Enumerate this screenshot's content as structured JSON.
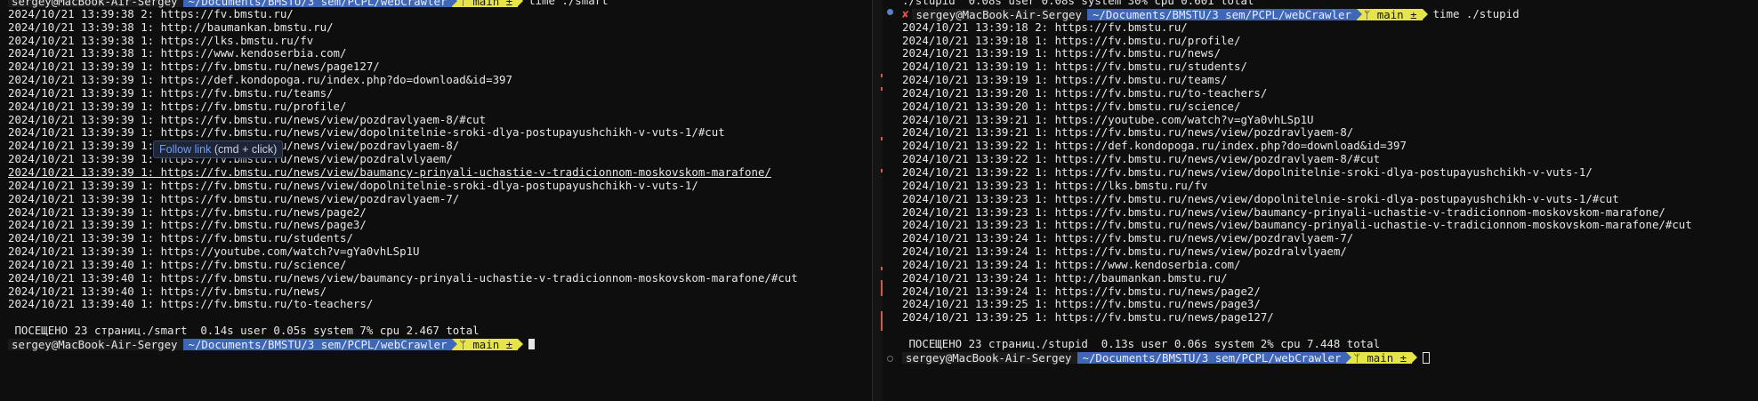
{
  "prompt": {
    "user_host": "sergey@MacBook-Air-Sergey",
    "path": "~/Documents/BMSTU/3 sem/PCPL/webCrawler",
    "git": "ᛘ main ±",
    "status_x": "✘"
  },
  "left": {
    "top_command": "time ./smart",
    "lines": [
      "2024/10/21 13:39:38 2: https://fv.bmstu.ru/",
      "2024/10/21 13:39:38 1: http://baumankan.bmstu.ru/",
      "2024/10/21 13:39:38 1: https://lks.bmstu.ru/fv",
      "2024/10/21 13:39:38 1: https://www.kendoserbia.com/",
      "2024/10/21 13:39:39 1: https://fv.bmstu.ru/news/page127/",
      "2024/10/21 13:39:39 1: https://def.kondopoga.ru/index.php?do=download&id=397",
      "2024/10/21 13:39:39 1: https://fv.bmstu.ru/teams/",
      "2024/10/21 13:39:39 1: https://fv.bmstu.ru/profile/",
      "2024/10/21 13:39:39 1: https://fv.bmstu.ru/news/view/pozdravlyaem-8/#cut",
      "2024/10/21 13:39:39 1: https://fv.bmstu.ru/news/view/dopolnitelnie-sroki-dlya-postupayushchikh-v-vuts-1/#cut",
      "2024/10/21 13:39:39 1: https://fv.bmstu.ru/news/view/pozdravlyaem-8/",
      "2024/10/21 13:39:39 1: https://fv.bmstu.ru/news/view/pozdralvlyaem/",
      "2024/10/21 13:39:39 1: https://fv.bmstu.ru/news/view/baumancy-prinyali-uchastie-v-tradicionnom-moskovskom-marafone/",
      "2024/10/21 13:39:39 1: https://fv.bmstu.ru/news/view/dopolnitelnie-sroki-dlya-postupayushchikh-v-vuts-1/",
      "2024/10/21 13:39:39 1: https://fv.bmstu.ru/news/view/pozdravlyaem-7/",
      "2024/10/21 13:39:39 1: https://fv.bmstu.ru/news/page2/",
      "2024/10/21 13:39:39 1: https://fv.bmstu.ru/news/page3/",
      "2024/10/21 13:39:39 1: https://fv.bmstu.ru/students/",
      "2024/10/21 13:39:39 1: https://youtube.com/watch?v=gYa0vhLSp1U",
      "2024/10/21 13:39:40 1: https://fv.bmstu.ru/science/",
      "2024/10/21 13:39:40 1: https://fv.bmstu.ru/news/view/baumancy-prinyali-uchastie-v-tradicionnom-moskovskom-marafone/#cut",
      "2024/10/21 13:39:40 1: https://fv.bmstu.ru/news/",
      "2024/10/21 13:39:40 1: https://fv.bmstu.ru/to-teachers/"
    ],
    "summary": " ПОСЕЩЕНО 23 страниц./smart  0.14s user 0.05s system 7% cpu 2.467 total"
  },
  "tooltip": {
    "link_label": "Follow link",
    "hint": "(cmd + click)"
  },
  "right": {
    "top_line": "./stupid  0.08s user 0.08s system 30% cpu 0.601 total",
    "command": "time ./stupid",
    "lines": [
      "2024/10/21 13:39:18 2: https://fv.bmstu.ru/",
      "2024/10/21 13:39:18 1: https://fv.bmstu.ru/profile/",
      "2024/10/21 13:39:19 1: https://fv.bmstu.ru/news/",
      "2024/10/21 13:39:19 1: https://fv.bmstu.ru/students/",
      "2024/10/21 13:39:19 1: https://fv.bmstu.ru/teams/",
      "2024/10/21 13:39:20 1: https://fv.bmstu.ru/to-teachers/",
      "2024/10/21 13:39:20 1: https://fv.bmstu.ru/science/",
      "2024/10/21 13:39:21 1: https://youtube.com/watch?v=gYa0vhLSp1U",
      "2024/10/21 13:39:21 1: https://fv.bmstu.ru/news/view/pozdravlyaem-8/",
      "2024/10/21 13:39:22 1: https://def.kondopoga.ru/index.php?do=download&id=397",
      "2024/10/21 13:39:22 1: https://fv.bmstu.ru/news/view/pozdravlyaem-8/#cut",
      "2024/10/21 13:39:22 1: https://fv.bmstu.ru/news/view/dopolnitelnie-sroki-dlya-postupayushchikh-v-vuts-1/",
      "2024/10/21 13:39:23 1: https://lks.bmstu.ru/fv",
      "2024/10/21 13:39:23 1: https://fv.bmstu.ru/news/view/dopolnitelnie-sroki-dlya-postupayushchikh-v-vuts-1/#cut",
      "2024/10/21 13:39:23 1: https://fv.bmstu.ru/news/view/baumancy-prinyali-uchastie-v-tradicionnom-moskovskom-marafone/",
      "2024/10/21 13:39:23 1: https://fv.bmstu.ru/news/view/baumancy-prinyali-uchastie-v-tradicionnom-moskovskom-marafone/#cut",
      "2024/10/21 13:39:24 1: https://fv.bmstu.ru/news/view/pozdravlyaem-7/",
      "2024/10/21 13:39:24 1: https://fv.bmstu.ru/news/view/pozdralvlyaem/",
      "2024/10/21 13:39:24 1: https://www.kendoserbia.com/",
      "2024/10/21 13:39:24 1: http://baumankan.bmstu.ru/",
      "2024/10/21 13:39:24 1: https://fv.bmstu.ru/news/page2/",
      "2024/10/21 13:39:25 1: https://fv.bmstu.ru/news/page3/",
      "2024/10/21 13:39:25 1: https://fv.bmstu.ru/news/page127/"
    ],
    "summary": " ПОСЕЩЕНО 23 страниц./stupid  0.13s user 0.06s system 2% cpu 7.448 total"
  },
  "colors": {
    "background": "#0e0e0e",
    "path_segment": "#3f66b7",
    "git_segment": "#e5e54a",
    "error_mark": "#e0574a",
    "link": "#6f9cf2"
  }
}
